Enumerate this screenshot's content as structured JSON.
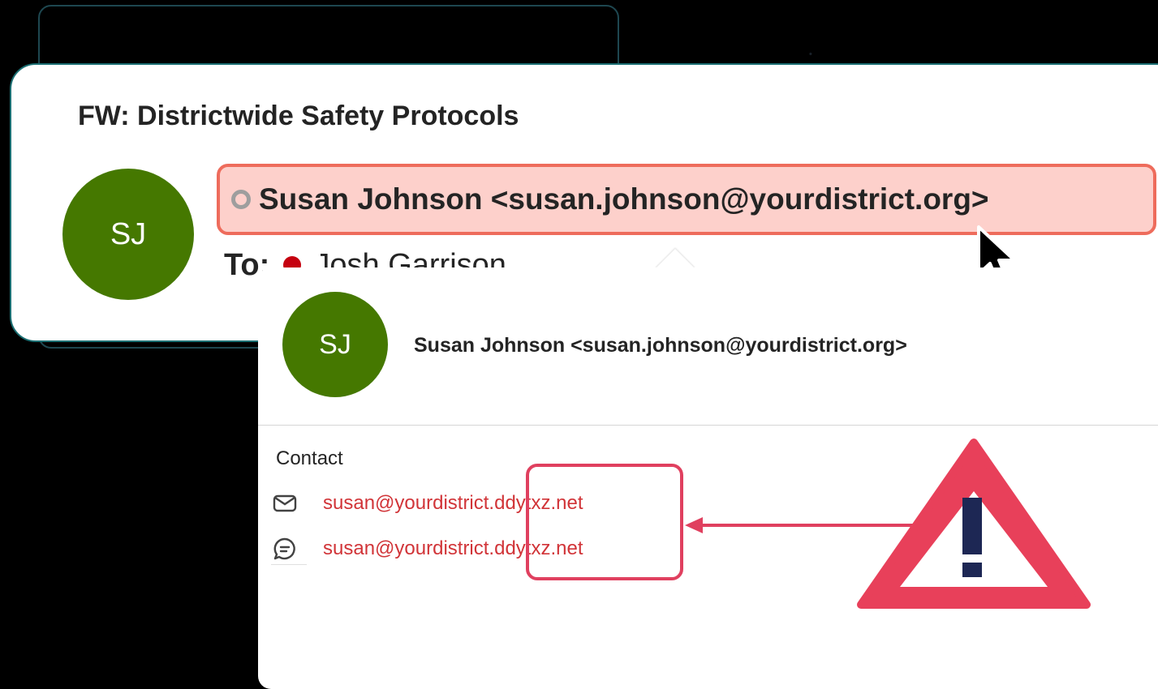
{
  "email": {
    "subject": "FW: Districtwide Safety Protocols",
    "sender_initials": "SJ",
    "sender_display": "Susan Johnson <susan.johnson@yourdistrict.org>",
    "to_label": "To:",
    "to_recipient": "Josh Garrison"
  },
  "contact_card": {
    "initials": "SJ",
    "name": "Susan Johnson <susan.johnson@yourdistrict.org>",
    "section_heading": "Contact",
    "email_address": "susan@yourdistrict.ddytxz.net",
    "chat_address": "susan@yourdistrict.ddytxz.net"
  },
  "colors": {
    "avatar": "#457800",
    "sender_highlight": "#fdd0cb",
    "sender_border": "#ee6c5c",
    "warning": "#e8405a",
    "link": "#d13438"
  },
  "icons": [
    "presence-offline-icon",
    "mail-icon",
    "chat-icon",
    "mouse-cursor-icon",
    "warning-triangle-icon"
  ]
}
